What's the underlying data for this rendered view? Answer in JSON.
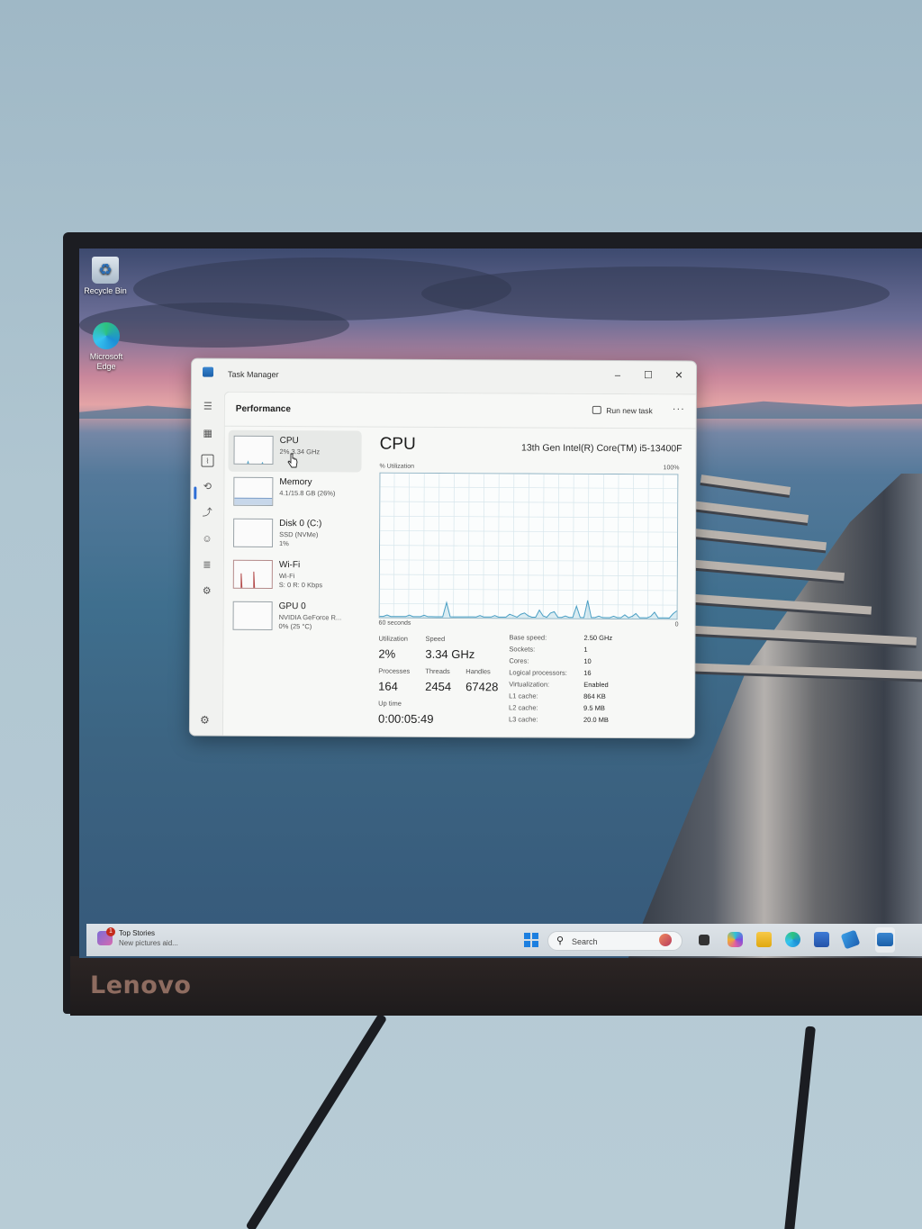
{
  "desktop": {
    "icons": [
      {
        "label": "Recycle Bin"
      },
      {
        "label": "Microsoft Edge"
      }
    ],
    "monitor_brand": "Lenovo"
  },
  "window": {
    "title": "Task Manager",
    "controls": {
      "minimize": "–",
      "maximize": "☐",
      "close": "✕"
    }
  },
  "header": {
    "title": "Performance",
    "run_new_task": "Run new task",
    "more": "···"
  },
  "perf_list": [
    {
      "title": "CPU",
      "sub1": "2%  3.34 GHz",
      "sub2": ""
    },
    {
      "title": "Memory",
      "sub1": "4.1/15.8 GB (26%)",
      "sub2": ""
    },
    {
      "title": "Disk 0 (C:)",
      "sub1": "SSD (NVMe)",
      "sub2": "1%"
    },
    {
      "title": "Wi-Fi",
      "sub1": "Wi-Fi",
      "sub2": "S: 0  R: 0 Kbps"
    },
    {
      "title": "GPU 0",
      "sub1": "NVIDIA GeForce R...",
      "sub2": "0%  (25 °C)"
    }
  ],
  "cpu": {
    "title": "CPU",
    "model": "13th Gen Intel(R) Core(TM) i5-13400F",
    "util_label": "% Utilization",
    "util_max": "100%",
    "time_span": "60 seconds",
    "axis_zero": "0",
    "graph_values": [
      0,
      0,
      1,
      0,
      0,
      0,
      0,
      0,
      1,
      0,
      0,
      0,
      1,
      0,
      0,
      0,
      0,
      0,
      10,
      0,
      0,
      0,
      0,
      0,
      0,
      0,
      0,
      1,
      0,
      0,
      0,
      1,
      0,
      0,
      0,
      2,
      1,
      0,
      2,
      3,
      1,
      0,
      0,
      5,
      1,
      0,
      3,
      4,
      0,
      0,
      1,
      0,
      0,
      8,
      0,
      0,
      12,
      0,
      0,
      1,
      0,
      0,
      0,
      1,
      0,
      0,
      2,
      0,
      1,
      3,
      0,
      0,
      0,
      1,
      4,
      0,
      0,
      0,
      0,
      3,
      5
    ]
  },
  "stats": {
    "utilization": {
      "label": "Utilization",
      "value": "2%"
    },
    "speed": {
      "label": "Speed",
      "value": "3.34 GHz"
    },
    "processes": {
      "label": "Processes",
      "value": "164"
    },
    "threads": {
      "label": "Threads",
      "value": "2454"
    },
    "handles": {
      "label": "Handles",
      "value": "67428"
    },
    "uptime": {
      "label": "Up time",
      "value": "0:00:05:49"
    }
  },
  "specs": [
    {
      "k": "Base speed:",
      "v": "2.50 GHz"
    },
    {
      "k": "Sockets:",
      "v": "1"
    },
    {
      "k": "Cores:",
      "v": "10"
    },
    {
      "k": "Logical processors:",
      "v": "16"
    },
    {
      "k": "Virtualization:",
      "v": "Enabled"
    },
    {
      "k": "L1 cache:",
      "v": "864 KB"
    },
    {
      "k": "L2 cache:",
      "v": "9.5 MB"
    },
    {
      "k": "L3 cache:",
      "v": "20.0 MB"
    }
  ],
  "taskbar": {
    "widget_title": "Top Stories",
    "widget_sub": "New pictures aid...",
    "widget_badge": "1",
    "search_placeholder": "Search",
    "apps": [
      "copilot-icon",
      "explorer-icon",
      "edge-icon",
      "store-icon",
      "remote-icon",
      "task-manager-icon"
    ]
  },
  "colors": {
    "accent": "#2f6fd6",
    "graph_line": "#4a9fc4",
    "graph_grid": "#d7e6ec"
  }
}
